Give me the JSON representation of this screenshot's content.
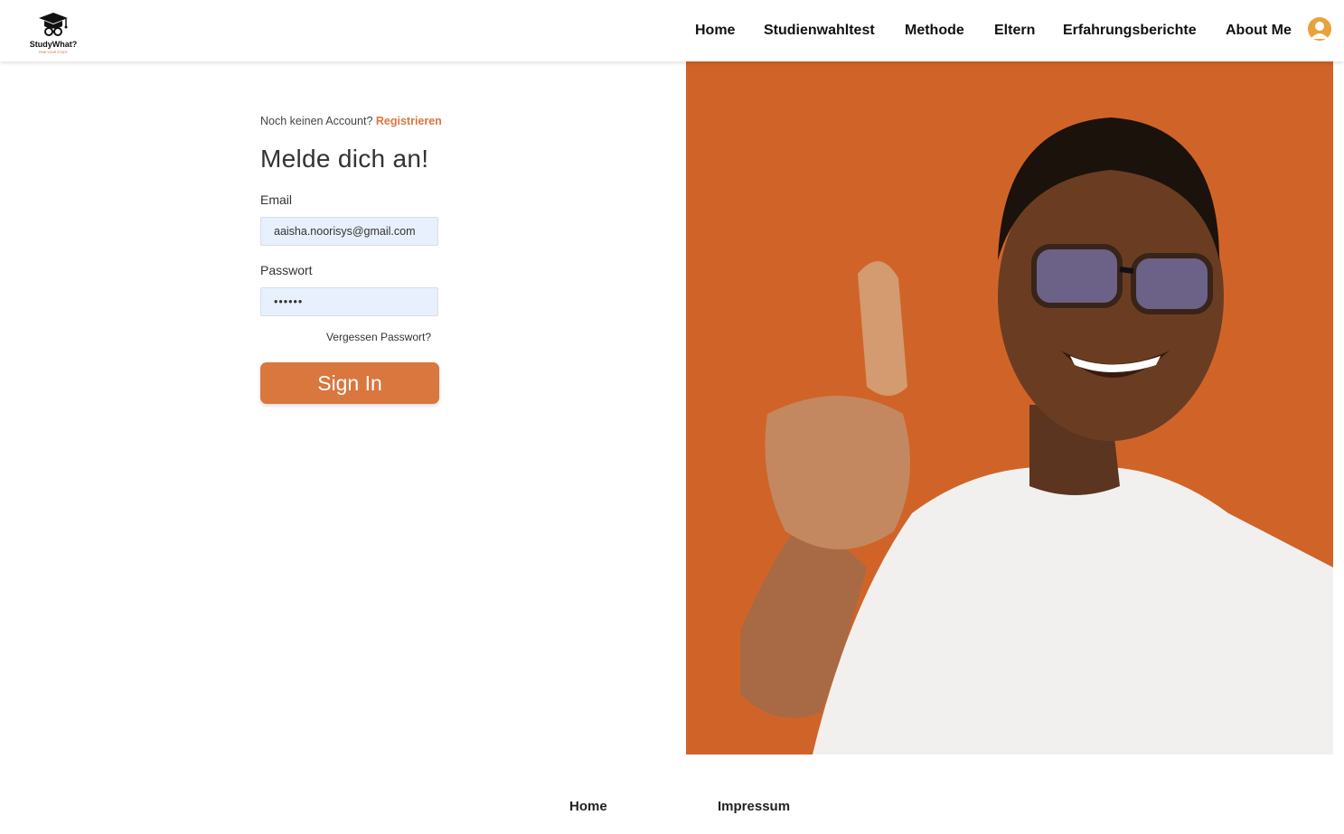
{
  "brand": {
    "name": "StudyWhat?",
    "tagline": "FIND YOUR STUDY"
  },
  "nav": {
    "items": [
      {
        "label": "Home"
      },
      {
        "label": "Studienwahltest"
      },
      {
        "label": "Methode"
      },
      {
        "label": "Eltern"
      },
      {
        "label": "Erfahrungsberichte"
      },
      {
        "label": "About Me"
      }
    ],
    "profile_icon": "user-circle-icon"
  },
  "login": {
    "no_account_text": "Noch keinen Account?",
    "register_link": "Registrieren",
    "heading": "Melde dich an!",
    "email_label": "Email",
    "email_value": "aaisha.noorisys@gmail.com",
    "password_label": "Passwort",
    "password_value": "••••••",
    "forgot_link": "Vergessen Passwort?",
    "submit_label": "Sign In"
  },
  "footer": {
    "links": [
      {
        "label": "Home"
      },
      {
        "label": "Impressum"
      }
    ]
  },
  "colors": {
    "accent": "#d9773f",
    "hero_bg": "#d06428",
    "avatar": "#e9a13b"
  }
}
